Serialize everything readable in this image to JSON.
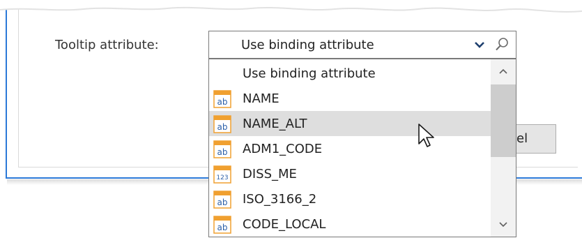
{
  "form": {
    "tooltip_label": "Tooltip attribute:",
    "combo_value": "Use binding attribute"
  },
  "background_button": {
    "visible_text": "el"
  },
  "dropdown": {
    "items": [
      {
        "label": "Use binding attribute",
        "icon": "none",
        "selected": false
      },
      {
        "label": "NAME",
        "icon": "text-field-icon",
        "selected": false
      },
      {
        "label": "NAME_ALT",
        "icon": "text-field-icon",
        "selected": true
      },
      {
        "label": "ADM1_CODE",
        "icon": "text-field-icon",
        "selected": false
      },
      {
        "label": "DISS_ME",
        "icon": "numeric-field-icon",
        "selected": false
      },
      {
        "label": "ISO_3166_2",
        "icon": "text-field-icon",
        "selected": false
      },
      {
        "label": "CODE_LOCAL",
        "icon": "text-field-icon",
        "selected": false
      }
    ],
    "text_icon_glyph": "ab",
    "numeric_icon_glyph": "123"
  },
  "colors": {
    "accent_border": "#2b79d8",
    "icon_header": "#f0a030",
    "icon_text": "#2b5fa8",
    "selected_row": "#dedede"
  }
}
